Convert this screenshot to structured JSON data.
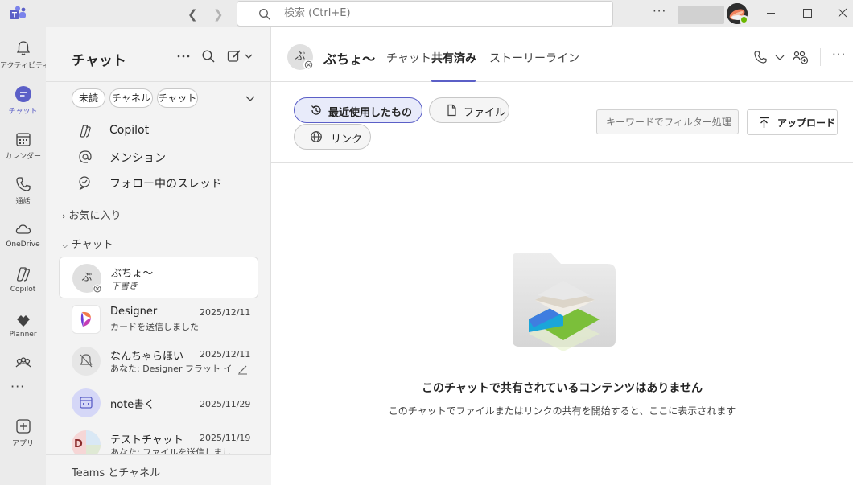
{
  "titlebar": {
    "search_placeholder": "検索 (Ctrl+E)",
    "more_label": "···"
  },
  "appbar": {
    "items": [
      {
        "label": "アクティビティ",
        "icon": "bell-icon"
      },
      {
        "label": "チャット",
        "icon": "chat-icon",
        "active": true
      },
      {
        "label": "カレンダー",
        "icon": "calendar-icon"
      },
      {
        "label": "通話",
        "icon": "phone-icon"
      },
      {
        "label": "OneDrive",
        "icon": "cloud-icon"
      },
      {
        "label": "Copilot",
        "icon": "copilot-icon"
      },
      {
        "label": "Planner",
        "icon": "planner-icon"
      },
      {
        "label": "",
        "icon": "people-icon"
      },
      {
        "label": "アプリ",
        "icon": "add-apps-icon"
      }
    ],
    "more_label": "···"
  },
  "chatpane": {
    "title": "チャット",
    "filters": [
      "未読",
      "チャネル",
      "チャット"
    ],
    "nav": [
      {
        "label": "Copilot",
        "icon": "copilot-icon"
      },
      {
        "label": "メンション",
        "icon": "at-icon"
      },
      {
        "label": "フォロー中のスレッド",
        "icon": "thread-icon"
      }
    ],
    "favorites_label": "お気に入り",
    "chats_label": "チャット",
    "chats": [
      {
        "name": "ぶちょ〜",
        "preview": "下書き",
        "date": "",
        "avatar_text": "ぶ",
        "selected": true
      },
      {
        "name": "Designer",
        "preview": "カードを送信しました",
        "date": "2025/12/11",
        "avatar_text": ""
      },
      {
        "name": "なんちゃらほい",
        "preview": "あなた: Designer フラット イラ...",
        "date": "2025/12/11",
        "avatar_text": ""
      },
      {
        "name": "note書く",
        "preview": "",
        "date": "2025/11/29",
        "avatar_text": ""
      },
      {
        "name": "テストチャット",
        "preview": "あなた: ファイルを送信しました",
        "date": "2025/11/19",
        "avatar_text": "D"
      }
    ],
    "footer_label": "Teams とチャネル"
  },
  "main": {
    "avatar_text": "ぶ",
    "title": "ぶちょ〜",
    "tabs": [
      "チャット",
      "共有済み",
      "ストーリーライン"
    ],
    "active_tab": "共有済み",
    "pills": [
      "最近使用したもの",
      "ファイル",
      "リンク"
    ],
    "filter_placeholder": "キーワードでフィルター処理",
    "upload_label": "アップロード",
    "empty_title": "このチャットで共有されているコンテンツはありません",
    "empty_desc": "このチャットでファイルまたはリンクの共有を開始すると、ここに表示されます",
    "more_label": "···"
  },
  "colors": {
    "accent": "#5b5fc7",
    "chrome": "#ebebeb",
    "pane": "#f3f3f3",
    "presence": "#6bb700"
  }
}
